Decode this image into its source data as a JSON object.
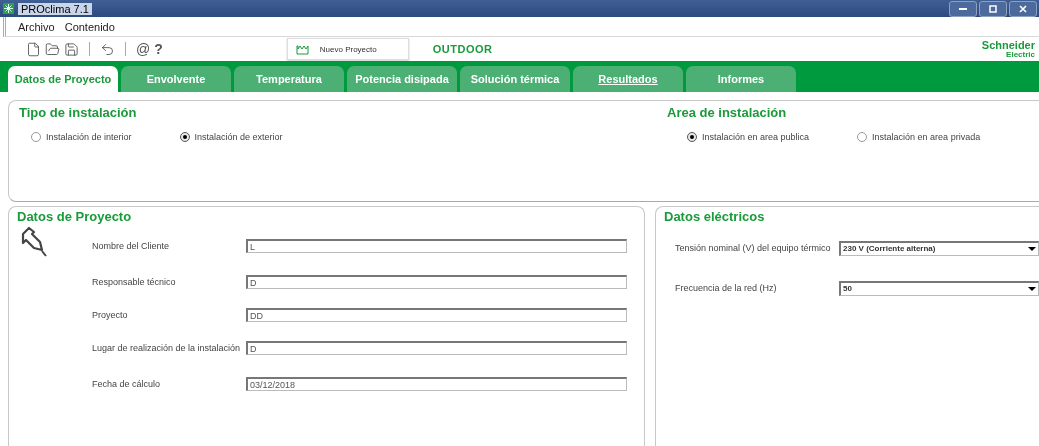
{
  "window": {
    "title": "PROclima 7.1"
  },
  "menu": [
    "Archivo",
    "Contenido"
  ],
  "toolbar": {
    "glyphs": [
      "@",
      "?"
    ],
    "project_name": "Nuevo Proyecto",
    "mode": "OUTDOOR",
    "logo": {
      "name": "Schneider",
      "sub": "Electric"
    }
  },
  "tabs": [
    {
      "label": "Datos de Proyecto",
      "selected": true,
      "underlined": false
    },
    {
      "label": "Envolvente",
      "selected": false,
      "underlined": false
    },
    {
      "label": "Temperatura",
      "selected": false,
      "underlined": false
    },
    {
      "label": "Potencia disipada",
      "selected": false,
      "underlined": false
    },
    {
      "label": "Solución térmica",
      "selected": false,
      "underlined": false
    },
    {
      "label": "Resultados",
      "selected": false,
      "underlined": true
    },
    {
      "label": "Informes",
      "selected": false,
      "underlined": false
    }
  ],
  "installation_type": {
    "title": "Tipo de instalación",
    "options": [
      {
        "label": "Instalación de interior",
        "selected": false
      },
      {
        "label": "Instalación de exterior",
        "selected": true
      }
    ]
  },
  "installation_area": {
    "title": "Area de instalación",
    "options": [
      {
        "label": "Instalación en area publica",
        "selected": true
      },
      {
        "label": "Instalación en area privada",
        "selected": false
      }
    ]
  },
  "project_data": {
    "title": "Datos de Proyecto",
    "fields": [
      {
        "label": "Nombre del Cliente",
        "value": "L"
      },
      {
        "label": "Responsable técnico",
        "value": "D"
      },
      {
        "label": "Proyecto",
        "value": "DD"
      },
      {
        "label": "Lugar de realización de la instalación",
        "value": "D"
      },
      {
        "label": "Fecha de cálculo",
        "value": "03/12/2018"
      }
    ]
  },
  "electrical_data": {
    "title": "Datos eléctricos",
    "fields": [
      {
        "label": "Tensión nominal (V) del equipo térmico",
        "value": "230 V (Corriente alterna)"
      },
      {
        "label": "Frecuencia de la red (Hz)",
        "value": "50"
      }
    ]
  }
}
